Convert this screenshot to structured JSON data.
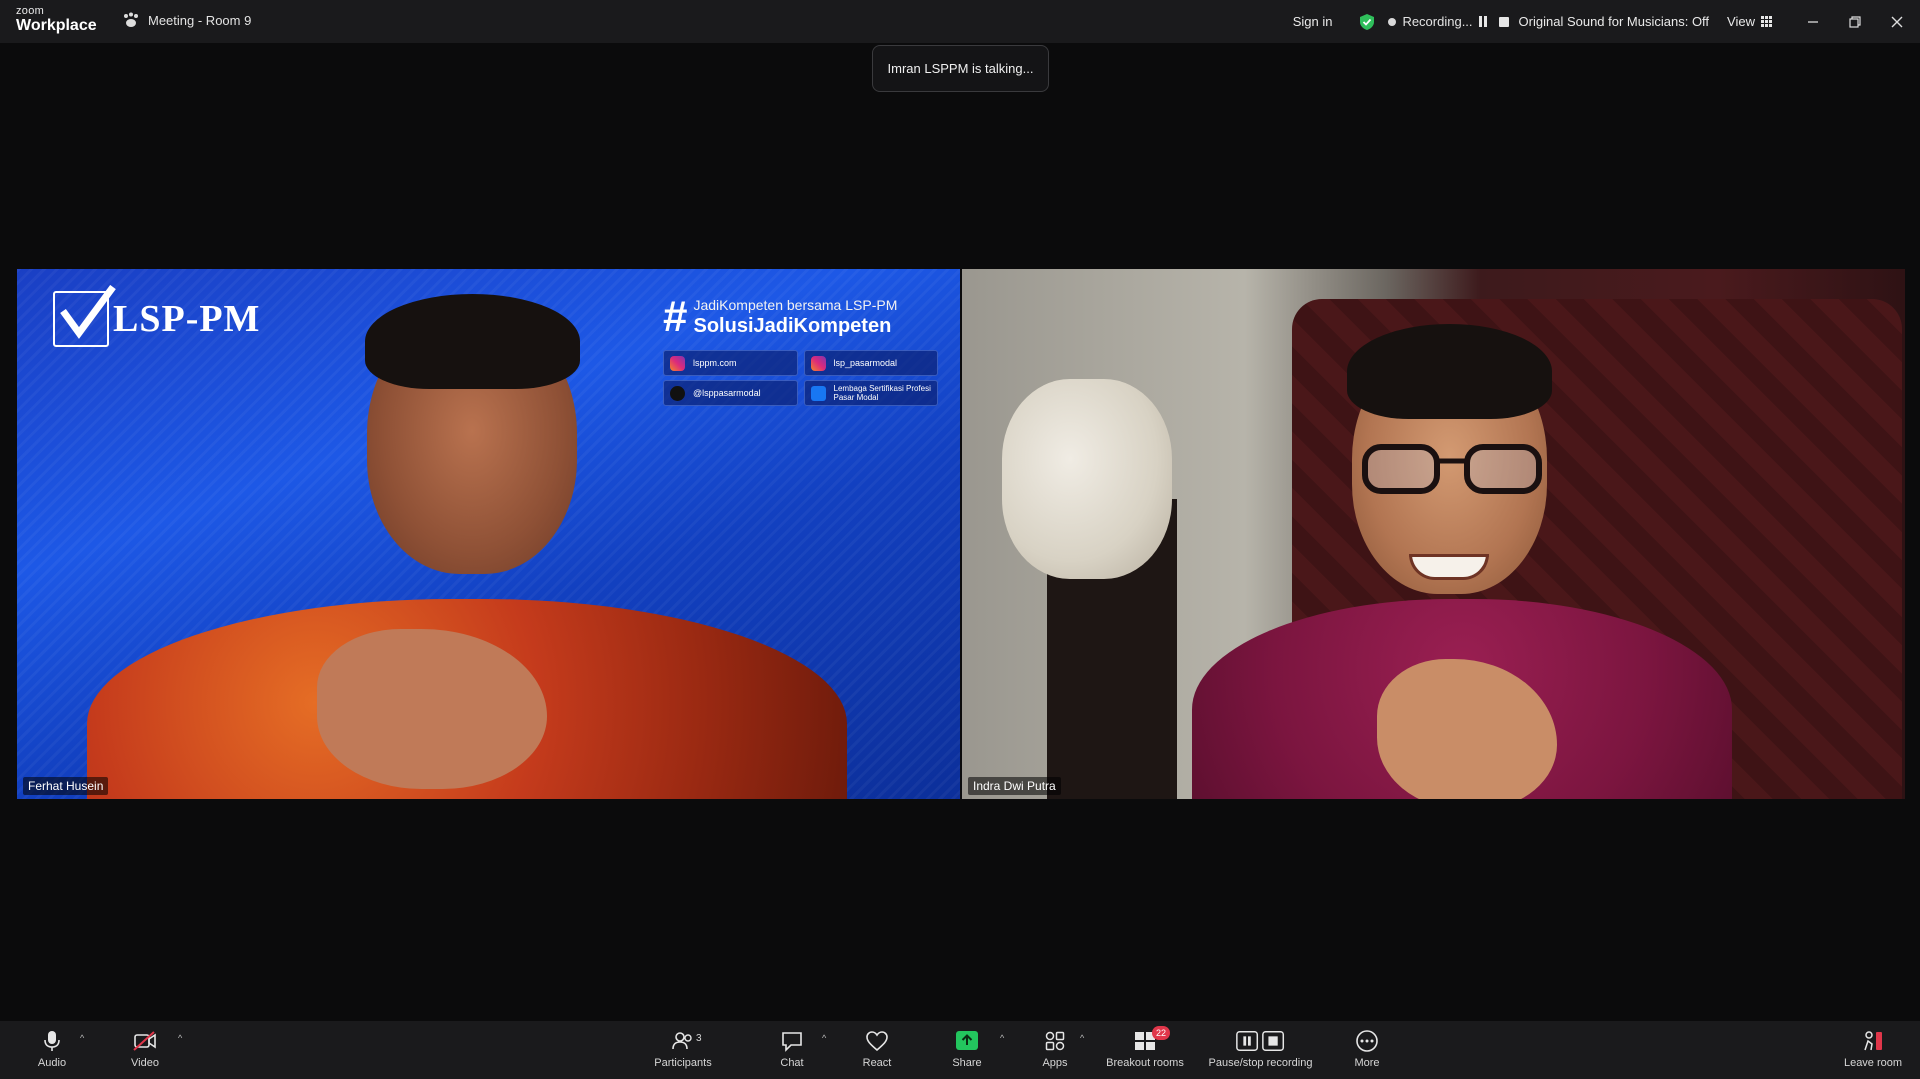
{
  "app": {
    "logo_top": "zoom",
    "logo_bottom": "Workplace"
  },
  "meeting": {
    "title": "Meeting - Room 9"
  },
  "header": {
    "sign_in": "Sign in",
    "recording_label": "Recording...",
    "original_sound": "Original Sound for Musicians: Off",
    "view_label": "View"
  },
  "toast": {
    "text": "Imran LSPPM is talking..."
  },
  "participants": [
    {
      "name": "Ferhat Husein",
      "background": {
        "logo_text": "LSP-PM",
        "logo_small": "LSP-PM",
        "hashtag_line1": "JadiKompeten bersama LSP-PM",
        "hashtag_line2": "SolusiJadiKompeten",
        "social": [
          {
            "icon": "instagram-icon",
            "text": "lsppm.com"
          },
          {
            "icon": "instagram-icon",
            "text": "lsp_pasarmodal"
          },
          {
            "icon": "tiktok-icon",
            "text": "@lsppasarmodal"
          },
          {
            "icon": "social-icon",
            "text": "Lembaga Sertifikasi Profesi Pasar Modal"
          }
        ]
      }
    },
    {
      "name": "Indra Dwi Putra"
    }
  ],
  "toolbar": {
    "audio": "Audio",
    "video": "Video",
    "participants": "Participants",
    "participants_count": "3",
    "chat": "Chat",
    "react": "React",
    "share": "Share",
    "apps": "Apps",
    "breakout": "Breakout rooms",
    "breakout_badge": "22",
    "pause_stop": "Pause/stop recording",
    "more": "More",
    "leave": "Leave room"
  },
  "colors": {
    "share_green": "#23c55e",
    "leave_red": "#e0364a",
    "shield_green": "#2fbf5b",
    "tile_left_blue": "#1d58e6"
  }
}
